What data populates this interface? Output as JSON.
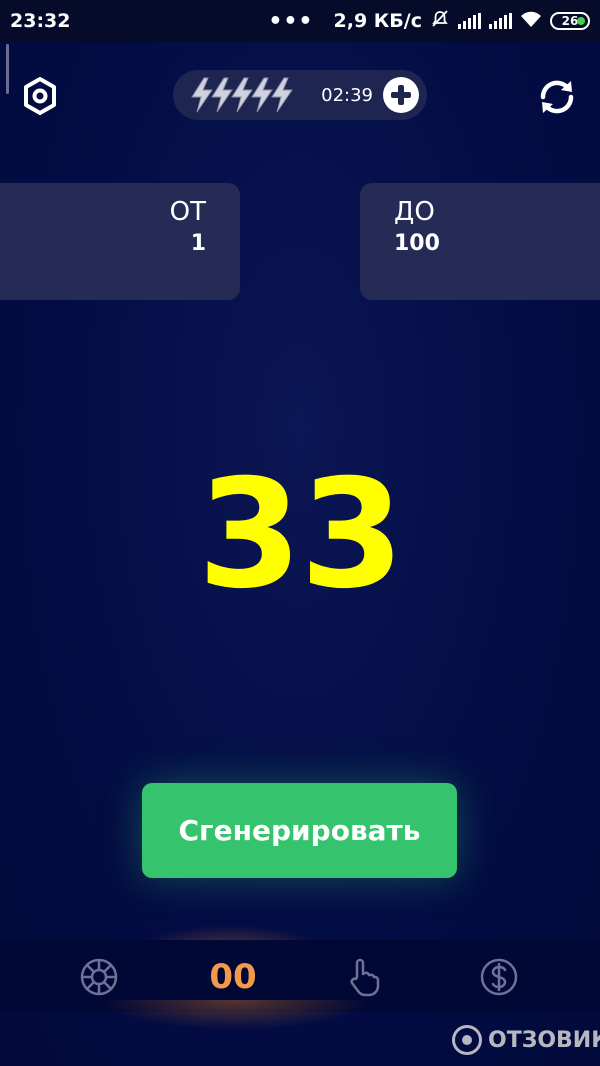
{
  "status_bar": {
    "time": "23:32",
    "dots": "•••",
    "net_speed": "2,9 КБ/с",
    "battery_level": "26"
  },
  "top_bar": {
    "settings_icon": "gear-icon",
    "energy_icon": "lightning-bolt-icon",
    "energy_count": 5,
    "timer": "02:39",
    "add_icon": "plus-circle-icon",
    "refresh_icon": "refresh-icon"
  },
  "range": {
    "from_label": "ОТ",
    "from_value": "1",
    "to_label": "ДО",
    "to_value": "100"
  },
  "result": {
    "value": "33"
  },
  "generate_button": {
    "label": "Сгенерировать"
  },
  "bottom_nav": {
    "items": [
      {
        "icon": "wheel-icon"
      },
      {
        "label": "00"
      },
      {
        "icon": "hand-pointer-icon"
      },
      {
        "icon": "dollar-coin-icon"
      }
    ]
  },
  "watermark": {
    "text": "ОТЗОВИК"
  },
  "colors": {
    "background": "#030d45",
    "card": "#252b55",
    "result": "#ffff00",
    "button": "#35c46d",
    "counter": "#f29a4a"
  }
}
